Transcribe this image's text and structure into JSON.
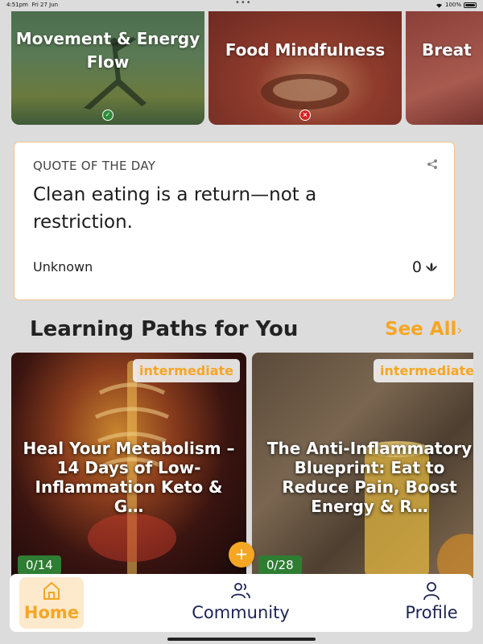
{
  "status_bar": {
    "time": "4:51pm",
    "date": "Fri 27 Jun",
    "battery": "100%"
  },
  "categories": [
    {
      "label": "Movement & Energy Flow",
      "status": "completed",
      "status_glyph": "✓"
    },
    {
      "label": "Food Mindfulness",
      "status": "failed",
      "status_glyph": "×"
    },
    {
      "label": "Breat"
    }
  ],
  "quote": {
    "kicker": "QUOTE OF THE DAY",
    "text": "Clean eating is a return—not a restriction.",
    "author": "Unknown",
    "likes": "0"
  },
  "learning_paths": {
    "title": "Learning Paths for You",
    "see_all": "See All",
    "see_all_chevron": "›",
    "items": [
      {
        "level": "intermediate",
        "title": "Heal Your Metabolism – 14 Days of Low-Inflammation Keto & G…",
        "progress": "0/14"
      },
      {
        "level": "intermediate",
        "title": "The Anti-Inflammatory Blueprint: Eat to Reduce Pain, Boost Energy & R…",
        "progress": "0/28"
      }
    ],
    "add_glyph": "+"
  },
  "tabs": [
    {
      "label": "Home",
      "icon": "home-icon",
      "active": true
    },
    {
      "label": "Community",
      "icon": "community-icon",
      "active": false
    },
    {
      "label": "Profile",
      "icon": "profile-icon",
      "active": false
    }
  ],
  "colors": {
    "accent": "#f5a623",
    "nav_text": "#1d2452",
    "success": "#2e7d32",
    "error": "#d32424"
  }
}
